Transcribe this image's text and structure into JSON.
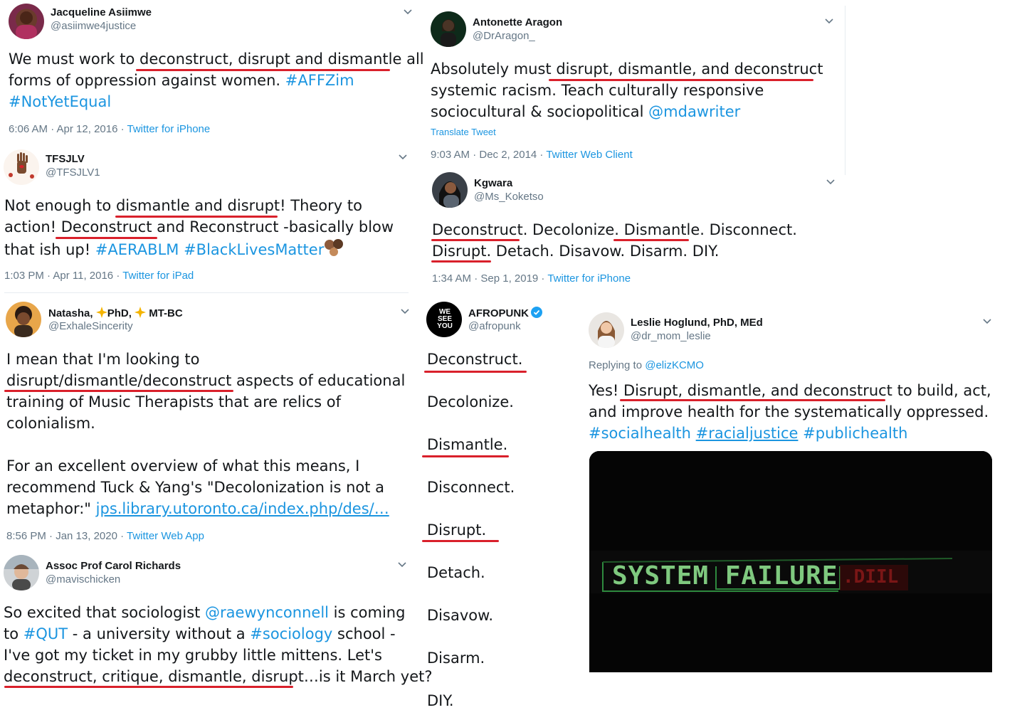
{
  "tweets": {
    "t1": {
      "name": "Jacqueline Asiimwe",
      "handle": "@asiimwe4justice",
      "lines": [
        [
          "We must work to ",
          "deconstruct, disrupt and dismantle",
          " all"
        ],
        [
          "forms of oppression against women. ",
          "#AFFZim"
        ],
        [
          "#NotYetEqual"
        ]
      ],
      "time": "6:06 AM · Apr 12, 2016 · ",
      "source": "Twitter for iPhone"
    },
    "t2": {
      "name": "TFSJLV",
      "handle": "@TFSJLV1",
      "lines": [
        [
          "Not enough to ",
          "dismantle and disrupt!",
          "  Theory to"
        ],
        [
          "action!  ",
          "Deconstruct",
          " and Reconstruct -basically blow"
        ],
        [
          "that ish up! ",
          "#AERABLM",
          " ",
          "#BlackLivesMatter"
        ]
      ],
      "time": "1:03 PM · Apr 11, 2016 · ",
      "source": "Twitter for iPad"
    },
    "t3": {
      "name": "Natasha, ",
      "name_mid": "PhD, ",
      "name_end": "MT-BC",
      "handle": "@ExhaleSincerity",
      "lines": [
        [
          "I mean that I'm looking to"
        ],
        [
          "disrupt/dismantle/deconstruct",
          " aspects of educational"
        ],
        [
          "training of Music Therapists that are relics of"
        ],
        [
          "colonialism."
        ],
        [
          ""
        ],
        [
          "For an excellent overview of what this means, I"
        ],
        [
          "recommend Tuck & Yang's \"Decolonization is not a"
        ],
        [
          "metaphor:\" ",
          "jps.library.utoronto.ca/index.php/des/…"
        ]
      ],
      "time": "8:56 PM · Jan 13, 2020 · ",
      "source": "Twitter Web App"
    },
    "t4": {
      "name": "Assoc Prof Carol Richards",
      "handle": "@mavischicken",
      "lines": [
        [
          "So excited that sociologist ",
          "@raewynconnell",
          " is coming"
        ],
        [
          "to ",
          "#QUT",
          " - a university without a ",
          "#sociology",
          " school -"
        ],
        [
          "I've got my ticket in my grubby little mittens. Let's"
        ],
        [
          "deconstruct, critique, dismantle, disrupt…",
          "is it March yet?"
        ]
      ]
    },
    "t5": {
      "name": "Antonette Aragon",
      "handle": "@DrAragon_",
      "lines": [
        [
          "Absolutely must ",
          "disrupt, dismantle, and deconstruct"
        ],
        [
          "systemic racism. Teach culturally responsive"
        ],
        [
          "sociocultural & sociopolitical  ",
          "@mdawriter"
        ]
      ],
      "translate": "Translate Tweet",
      "time": "9:03 AM · Dec 2, 2014 · ",
      "source": "Twitter Web Client"
    },
    "t6": {
      "name": "Kgwara",
      "handle": "@Ms_Koketso",
      "lines": [
        [
          "Deconstruct",
          ". Decolonize. ",
          "Dismantle",
          ". Disconnect."
        ],
        [
          "Disrupt",
          ". Detach. Disavow. Disarm. DIY."
        ]
      ],
      "time": "1:34 AM · Sep 1, 2019 · ",
      "source": "Twitter for iPhone"
    },
    "t7": {
      "name": "AFROPUNK",
      "handle": "@afropunk",
      "avatar_text": [
        "WE",
        "SEE",
        "YOU"
      ],
      "words": [
        "Deconstruct.",
        "Decolonize.",
        "Dismantle.",
        "Disconnect.",
        "Disrupt.",
        "Detach.",
        "Disavow.",
        "Disarm.",
        "DIY."
      ]
    },
    "t8": {
      "name": "Leslie Hoglund, PhD, MEd",
      "handle": "@dr_mom_leslie",
      "reply_prefix": "Replying to ",
      "reply_to": "@elizKCMO",
      "lines": [
        [
          "Yes! ",
          "Disrupt, dismantle, and deconstruct",
          " to build, act,"
        ],
        [
          "and improve health for the systematically oppressed."
        ],
        [
          "#socialhealth",
          " ",
          "#racialjustice",
          " ",
          "#publichealth"
        ]
      ],
      "media_text": "SYSTEM FAILURE",
      "media_ghost": ".DIIL"
    }
  },
  "colors": {
    "link": "#1b95e0",
    "underline_red": "#d9202b",
    "meta_gray": "#657786",
    "media_green": "#7fc97f"
  }
}
